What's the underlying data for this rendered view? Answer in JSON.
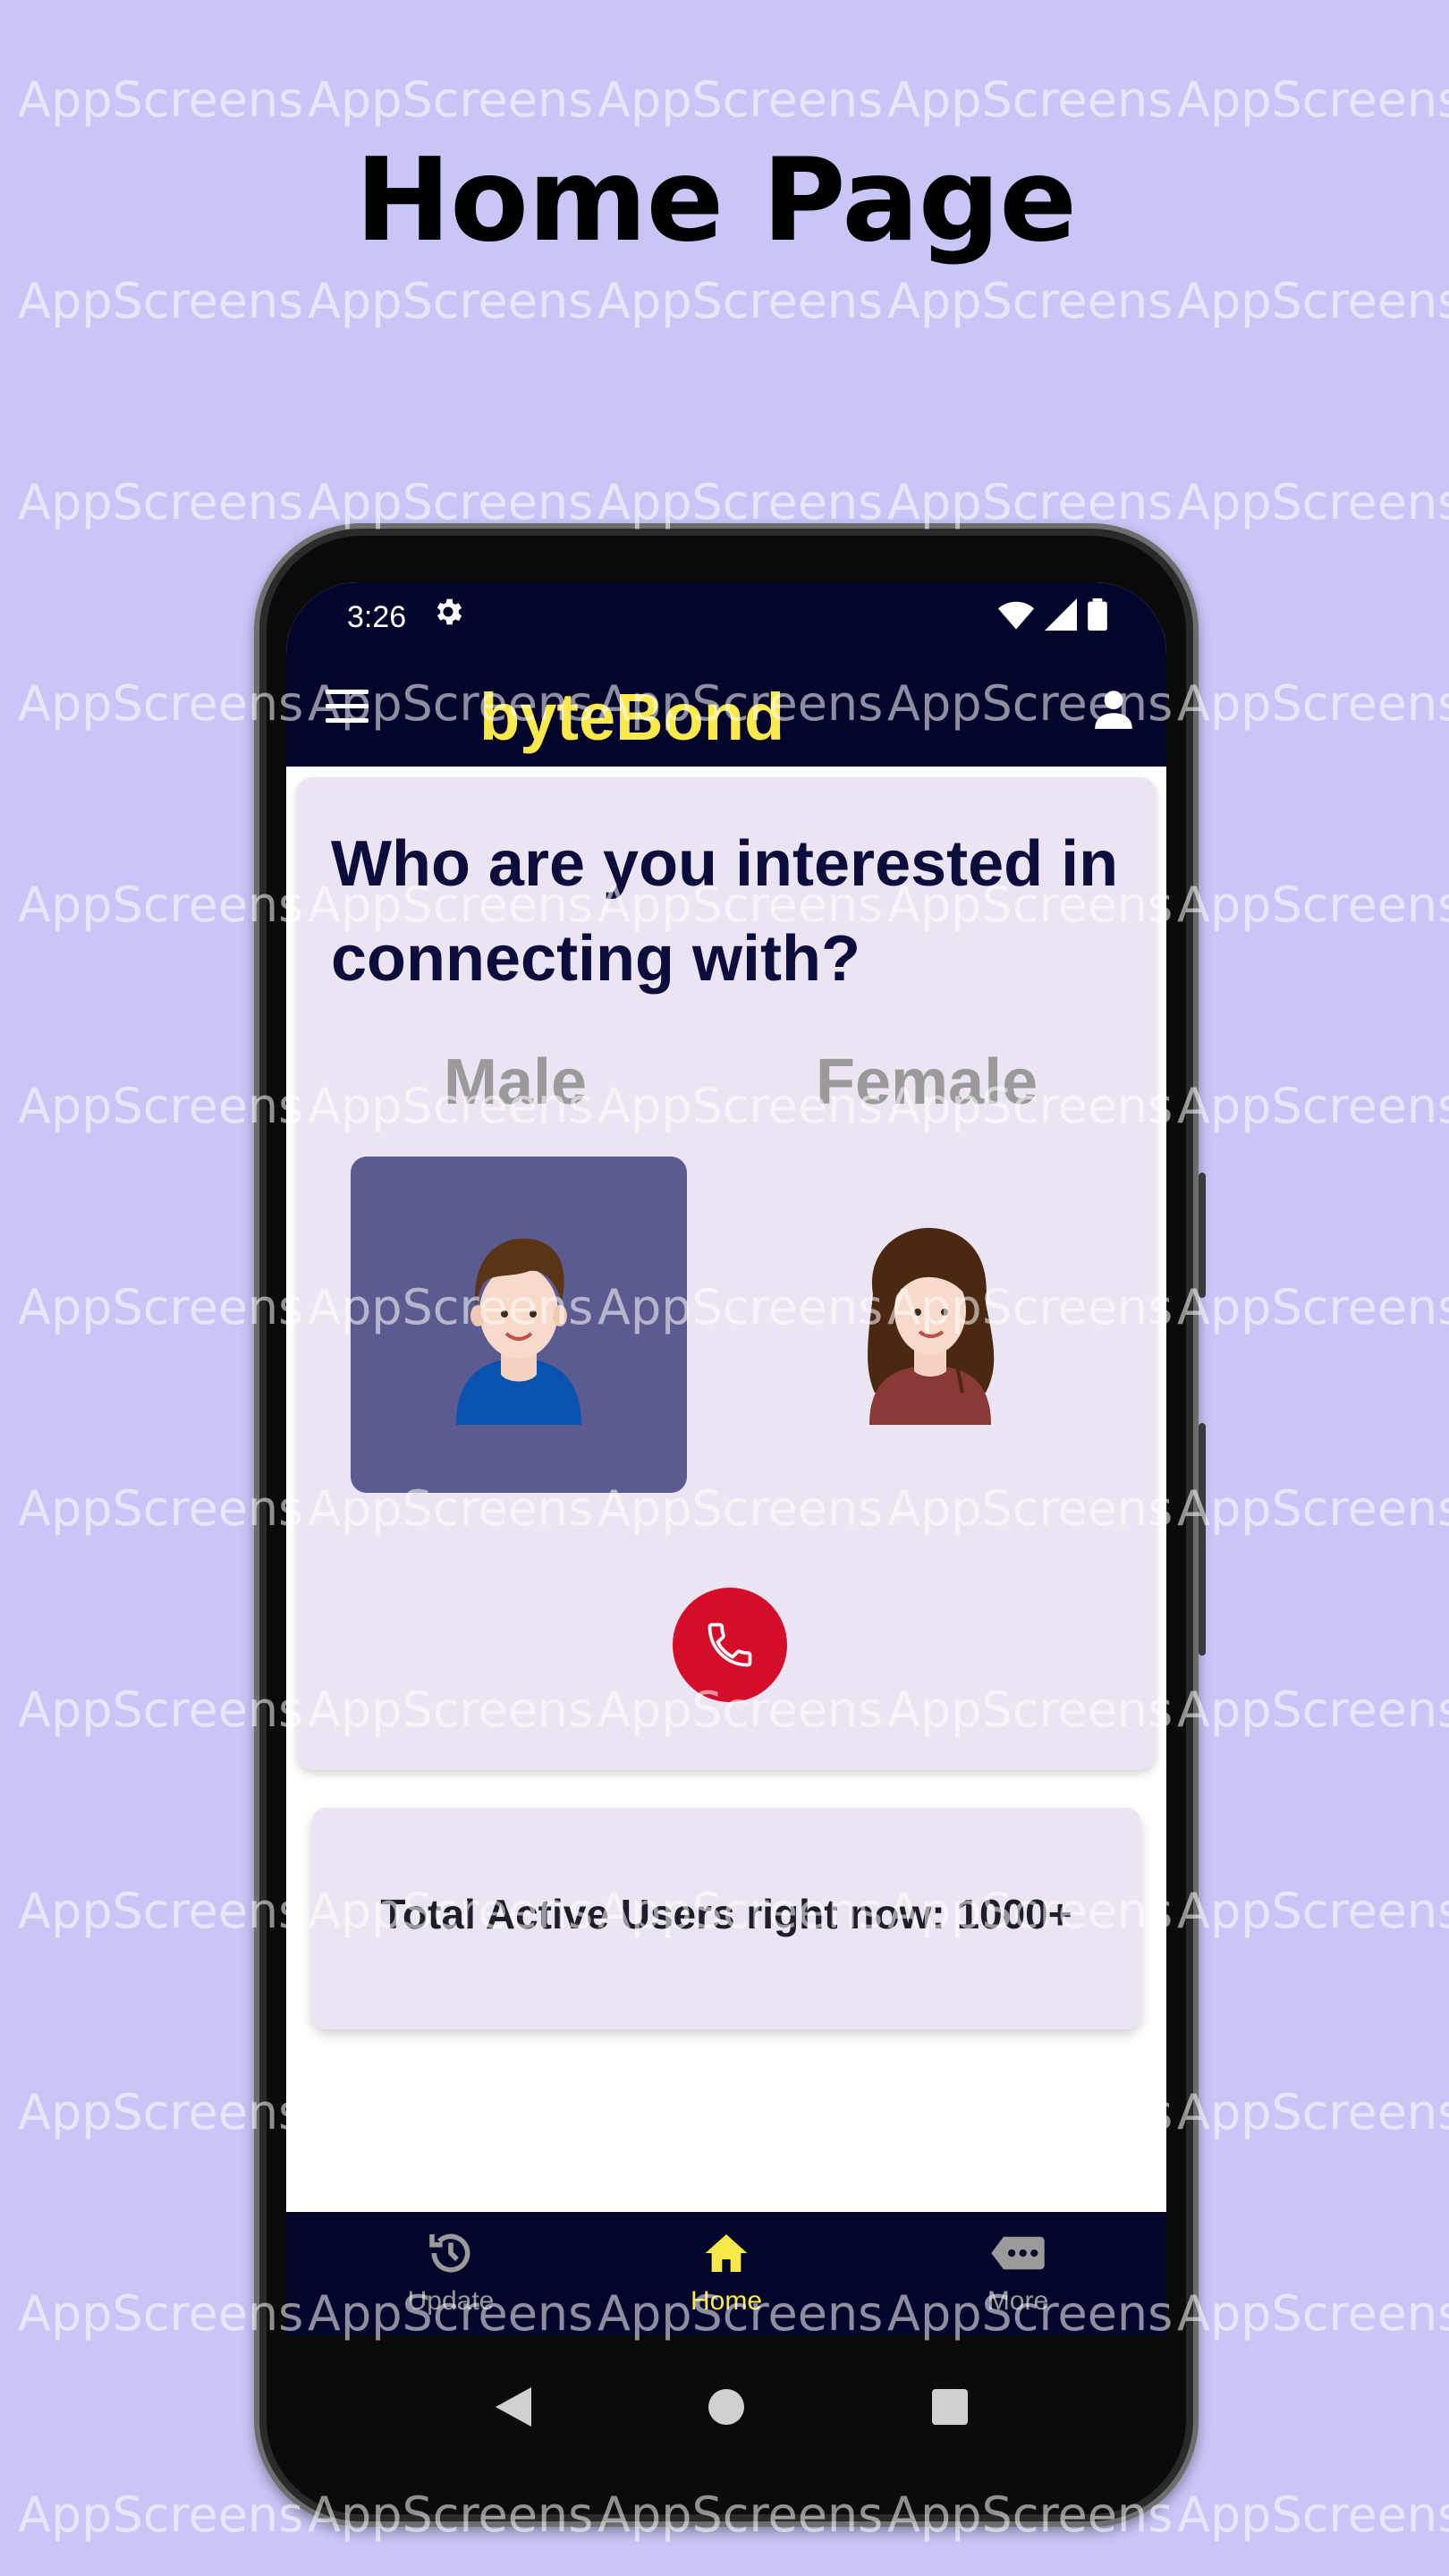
{
  "page_title": "Home Page",
  "watermark_text": "AppScreens",
  "status_bar": {
    "time": "3:26"
  },
  "app_bar": {
    "title": "byteBond"
  },
  "main_card": {
    "question": "Who are you interested in connecting with?",
    "options": [
      {
        "label": "Male",
        "selected": true
      },
      {
        "label": "Female",
        "selected": false
      }
    ]
  },
  "users_card": {
    "text": "Total Active Users right now: 1000+"
  },
  "bottom_nav": {
    "items": [
      {
        "label": "Update",
        "active": false,
        "icon": "history-icon"
      },
      {
        "label": "Home",
        "active": true,
        "icon": "home-icon"
      },
      {
        "label": "More",
        "active": false,
        "icon": "more-tag-icon"
      }
    ]
  },
  "colors": {
    "background": "#c8c6f7",
    "app_bar": "#03052c",
    "accent": "#fbe84a",
    "card": "#ebe4f2",
    "selected_box": "#5b5b92",
    "call_button": "#d50c2a",
    "inactive_nav": "#9a9a9a"
  }
}
